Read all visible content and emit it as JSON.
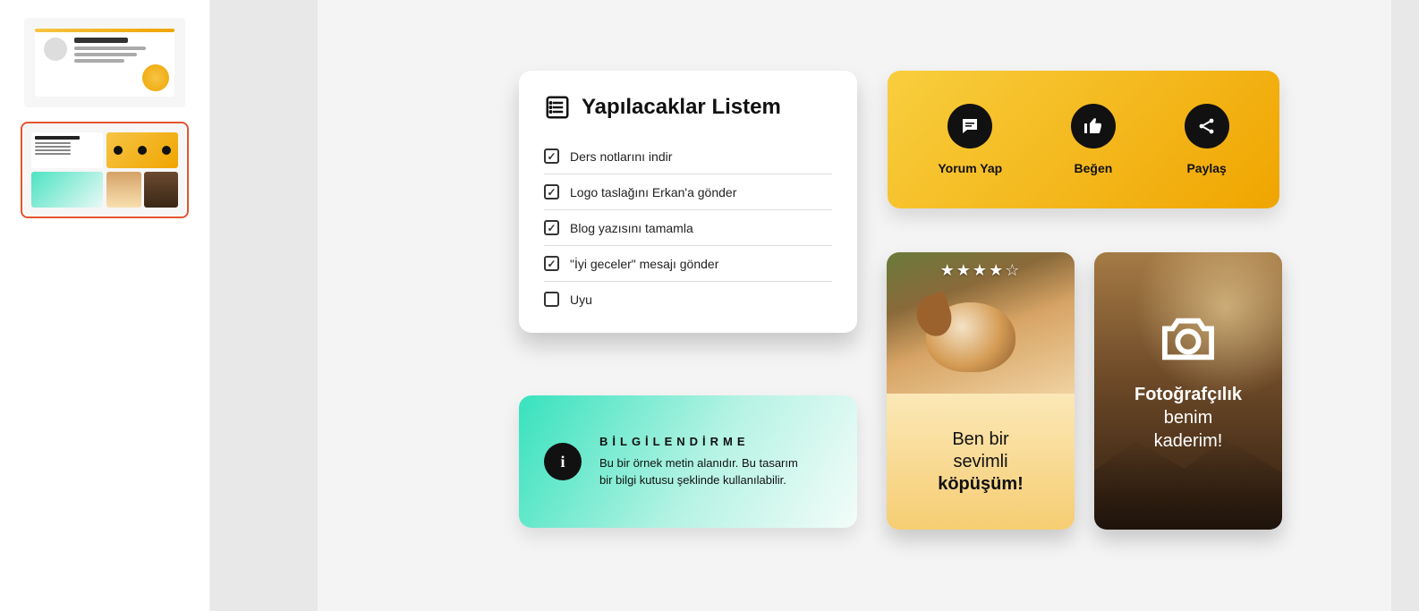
{
  "sidebar": {
    "thumbs": [
      {
        "active": false
      },
      {
        "active": true
      }
    ]
  },
  "todo": {
    "title": "Yapılacaklar Listem",
    "items": [
      {
        "label": "Ders notlarını indir",
        "checked": true
      },
      {
        "label": "Logo taslağını Erkan'a gönder",
        "checked": true
      },
      {
        "label": "Blog yazısını tamamla",
        "checked": true
      },
      {
        "label": "\"İyi geceler\" mesajı gönder",
        "checked": true
      },
      {
        "label": "Uyu",
        "checked": false
      }
    ]
  },
  "actions": {
    "comment": "Yorum Yap",
    "like": "Beğen",
    "share": "Paylaş"
  },
  "info": {
    "heading": "BİLGİLENDİRME",
    "body": "Bu bir örnek metin alanıdır. Bu tasarım bir bilgi kutusu şeklinde kullanılabilir."
  },
  "dog": {
    "rating": 4,
    "line1": "Ben bir",
    "line2": "sevimli",
    "line3": "köpüşüm!"
  },
  "photo": {
    "line1": "Fotoğrafçılık",
    "line2": "benim",
    "line3": "kaderim!"
  }
}
